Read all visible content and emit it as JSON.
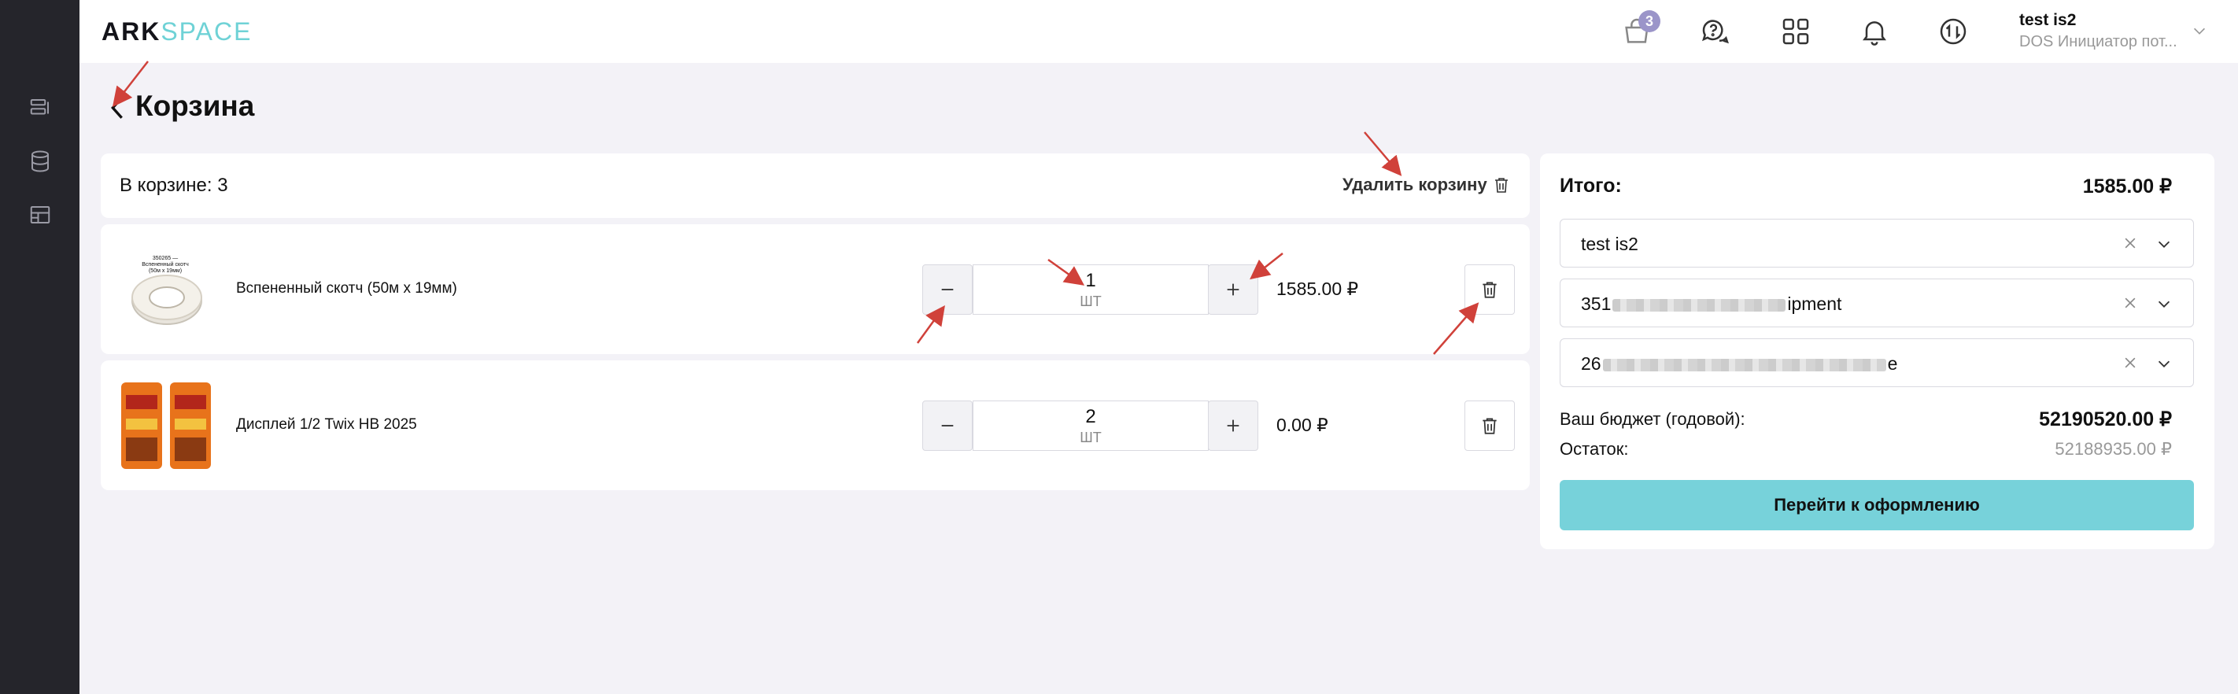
{
  "brand": {
    "part1": "ARK",
    "part2": "SPACE"
  },
  "header": {
    "cart_badge": "3",
    "user": {
      "name": "test is2",
      "role": "DOS Инициатор пот..."
    }
  },
  "page": {
    "title": "Корзина"
  },
  "cart": {
    "count_label": "В корзине: 3",
    "clear_label": "Удалить корзину",
    "items": [
      {
        "name": "Вспененный скотч (50м х 19мм)",
        "qty": "1",
        "unit": "ШТ",
        "price": "1585.00 ₽",
        "thumb_text": "350265 — Вспененный скотч (50м х 19мм)"
      },
      {
        "name": "Дисплей 1/2 Twix HB 2025",
        "qty": "2",
        "unit": "ШТ",
        "price": "0.00 ₽"
      }
    ]
  },
  "summary": {
    "total_label": "Итого:",
    "total_value": "1585.00 ₽",
    "select_user": "test is2",
    "select_project_prefix": "351",
    "select_project_suffix": "ipment",
    "select_location_prefix": "26",
    "select_location_suffix": "e",
    "budget_label": "Ваш бюджет (годовой):",
    "budget_value": "52190520.00 ₽",
    "remain_label": "Остаток:",
    "remain_value": "52188935.00 ₽",
    "checkout_label": "Перейти к оформлению"
  },
  "colors": {
    "accent": "#77d2da",
    "sidebar": "#25252b",
    "badge": "#9b95c9",
    "annotation": "#d0413a"
  }
}
